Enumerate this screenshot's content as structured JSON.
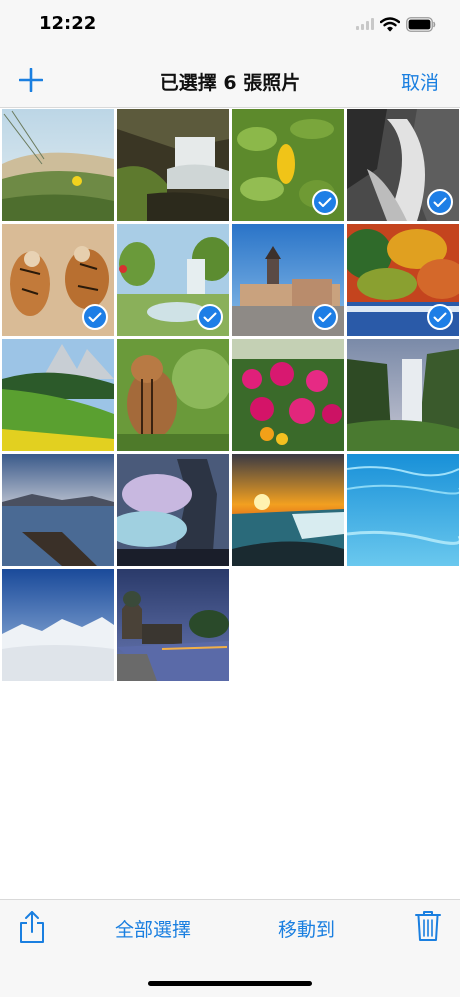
{
  "status_bar": {
    "time": "12:22",
    "icons": [
      "cellular-signal-icon",
      "wifi-icon",
      "battery-icon"
    ]
  },
  "nav": {
    "add_icon": "plus-icon",
    "title": "已選擇 6 張照片",
    "cancel_label": "取消"
  },
  "photos": [
    {
      "subject": "grassy beach dune",
      "selected": false
    },
    {
      "subject": "waterfall with mossy rocks",
      "selected": false
    },
    {
      "subject": "green leaves with yellow leaf",
      "selected": true
    },
    {
      "subject": "black and white waterfall",
      "selected": true
    },
    {
      "subject": "two tigers playing",
      "selected": true
    },
    {
      "subject": "garden pond with waterfall",
      "selected": true
    },
    {
      "subject": "old town with towers",
      "selected": true
    },
    {
      "subject": "autumn forest and river",
      "selected": true
    },
    {
      "subject": "green meadow with mountains",
      "selected": false
    },
    {
      "subject": "chipmunk",
      "selected": false
    },
    {
      "subject": "pink flowers",
      "selected": false
    },
    {
      "subject": "waterfall on cliff",
      "selected": false
    },
    {
      "subject": "lake with pier at dusk",
      "selected": false
    },
    {
      "subject": "fantasy mountains",
      "selected": false
    },
    {
      "subject": "waterfall at sunset",
      "selected": false
    },
    {
      "subject": "underwater blue",
      "selected": false
    },
    {
      "subject": "snowy mountains and clouds",
      "selected": false
    },
    {
      "subject": "cathedral by river at night",
      "selected": false
    }
  ],
  "toolbar": {
    "share_icon": "share-icon",
    "select_all_label": "全部選擇",
    "move_to_label": "移動到",
    "trash_icon": "trash-icon"
  },
  "colors": {
    "accent": "#1a7fe0",
    "bar_background": "#f7f7f7",
    "check_background": "#1d7ee6"
  }
}
